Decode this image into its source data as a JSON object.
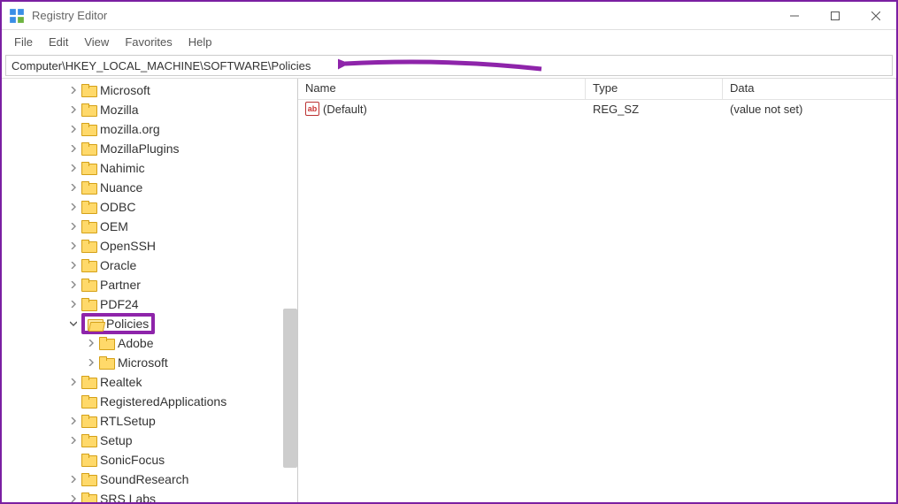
{
  "window": {
    "title": "Registry Editor"
  },
  "menu": {
    "file": "File",
    "edit": "Edit",
    "view": "View",
    "favorites": "Favorites",
    "help": "Help"
  },
  "address": "Computer\\HKEY_LOCAL_MACHINE\\SOFTWARE\\Policies",
  "tree": {
    "items": [
      {
        "label": "Microsoft",
        "indent": 70,
        "exp": ">"
      },
      {
        "label": "Mozilla",
        "indent": 70,
        "exp": ">"
      },
      {
        "label": "mozilla.org",
        "indent": 70,
        "exp": ">"
      },
      {
        "label": "MozillaPlugins",
        "indent": 70,
        "exp": ">"
      },
      {
        "label": "Nahimic",
        "indent": 70,
        "exp": ">"
      },
      {
        "label": "Nuance",
        "indent": 70,
        "exp": ">"
      },
      {
        "label": "ODBC",
        "indent": 70,
        "exp": ">"
      },
      {
        "label": "OEM",
        "indent": 70,
        "exp": ">"
      },
      {
        "label": "OpenSSH",
        "indent": 70,
        "exp": ">"
      },
      {
        "label": "Oracle",
        "indent": 70,
        "exp": ">"
      },
      {
        "label": "Partner",
        "indent": 70,
        "exp": ">"
      },
      {
        "label": "PDF24",
        "indent": 70,
        "exp": ">"
      },
      {
        "label": "Policies",
        "indent": 70,
        "exp": "v",
        "open": true,
        "highlight": true
      },
      {
        "label": "Adobe",
        "indent": 90,
        "exp": ">"
      },
      {
        "label": "Microsoft",
        "indent": 90,
        "exp": ">"
      },
      {
        "label": "Realtek",
        "indent": 70,
        "exp": ">"
      },
      {
        "label": "RegisteredApplications",
        "indent": 70,
        "exp": ""
      },
      {
        "label": "RTLSetup",
        "indent": 70,
        "exp": ">"
      },
      {
        "label": "Setup",
        "indent": 70,
        "exp": ">"
      },
      {
        "label": "SonicFocus",
        "indent": 70,
        "exp": ""
      },
      {
        "label": "SoundResearch",
        "indent": 70,
        "exp": ">"
      },
      {
        "label": "SRS Labs",
        "indent": 70,
        "exp": ">"
      }
    ]
  },
  "columns": {
    "name": "Name",
    "type": "Type",
    "data": "Data"
  },
  "values": [
    {
      "name": "(Default)",
      "type": "REG_SZ",
      "data": "(value not set)"
    }
  ]
}
